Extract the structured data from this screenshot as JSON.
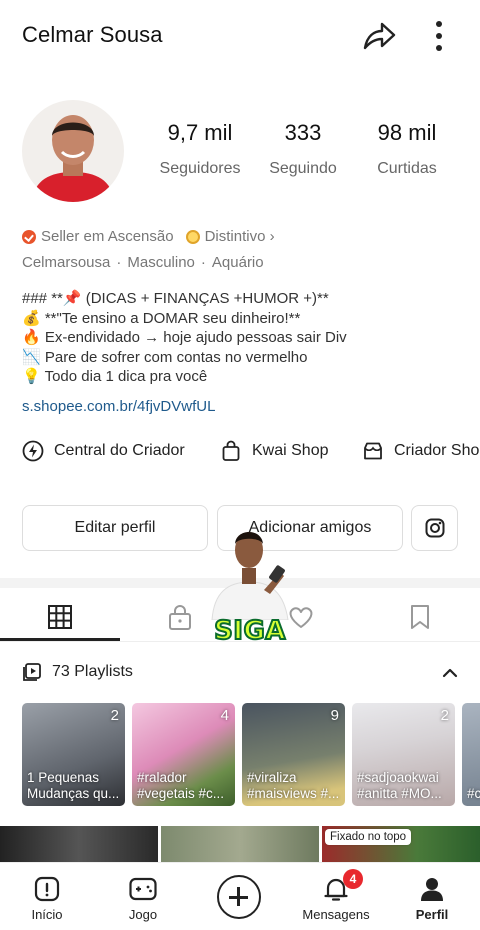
{
  "profile": {
    "name": "Celmar Sousa",
    "stats": [
      {
        "value": "9,7 mil",
        "label": "Seguidores"
      },
      {
        "value": "333",
        "label": "Seguindo"
      },
      {
        "value": "98 mil",
        "label": "Curtidas"
      }
    ],
    "badges": [
      {
        "label": "Seller em Ascensão"
      },
      {
        "label": "Distintivo ›"
      }
    ],
    "meta": [
      "Celmarsousa",
      "Masculino",
      "Aquário"
    ],
    "meta_sep": "·",
    "bio_lines": [
      "### **📌 (DICAS + FINANÇAS +HUMOR +)**",
      "💰 **\"Te ensino a DOMAR seu dinheiro!**",
      "🔥 Ex-endividado → hoje ajudo pessoas sair Div",
      "📉 Pare de sofrer com contas no vermelho",
      "💡 Todo dia 1 dica pra você"
    ],
    "link": "s.shopee.com.br/4fjvDVwfUL"
  },
  "tools": [
    {
      "label": "Central do Criador",
      "icon": "lightning-icon"
    },
    {
      "label": "Kwai Shop",
      "icon": "shopping-bag-icon"
    },
    {
      "label": "Criador Shop",
      "icon": "store-icon"
    }
  ],
  "buttons": {
    "edit": "Editar perfil",
    "add_friends": "Adicionar amigos"
  },
  "overlay": {
    "label": "SIGA"
  },
  "playlists": {
    "title": "73 Playlists",
    "items": [
      {
        "count": "2",
        "caption": "1 Pequenas Mudanças qu..."
      },
      {
        "count": "4",
        "caption": "#ralador #vegetais #c..."
      },
      {
        "count": "9",
        "caption": "#viraliza #maisviews #..."
      },
      {
        "count": "2",
        "caption": "#sadjoaokwai #anitta #MO..."
      },
      {
        "count": "",
        "caption": "#c #..."
      }
    ]
  },
  "pinned_label": "Fixado no topo",
  "nav": [
    {
      "label": "Início",
      "icon": "home-icon"
    },
    {
      "label": "Jogo",
      "icon": "gamepad-icon"
    },
    {
      "label": "",
      "icon": "create-plus-icon"
    },
    {
      "label": "Mensagens",
      "icon": "bell-icon",
      "badge": "4"
    },
    {
      "label": "Perfil",
      "icon": "person-icon"
    }
  ],
  "colors": {
    "link": "#1f5a8c",
    "badge": "#e8282e",
    "siga_text": "#d6ff33"
  }
}
